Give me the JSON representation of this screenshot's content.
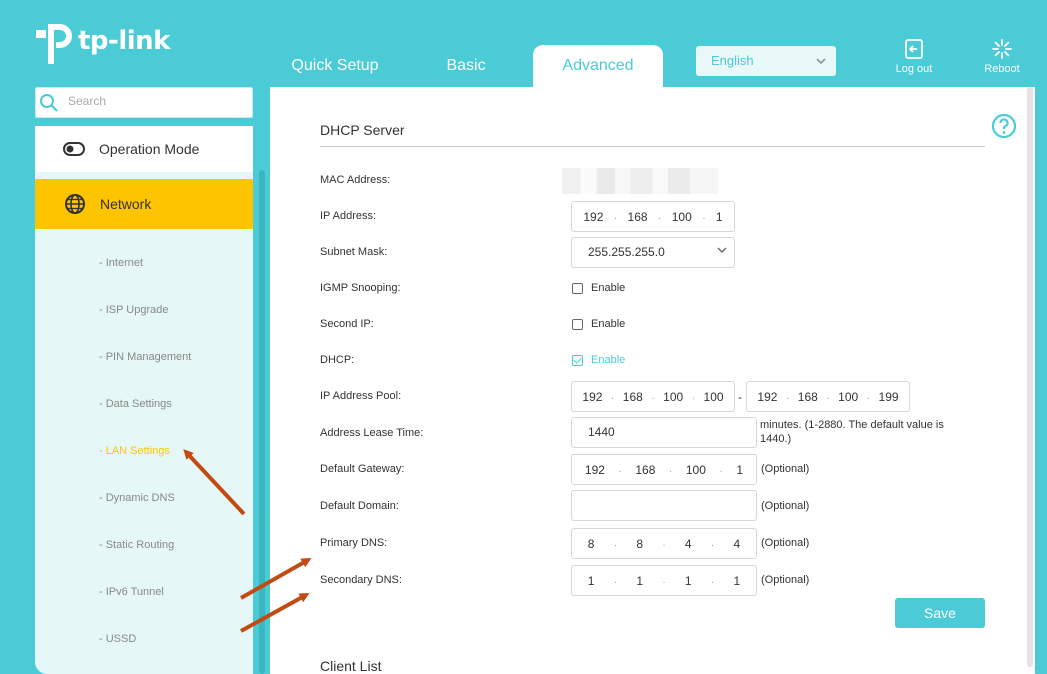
{
  "header": {
    "logo_text": "tp-link",
    "tabs": [
      {
        "label": "Quick Setup"
      },
      {
        "label": "Basic"
      },
      {
        "label": "Advanced"
      }
    ],
    "language": "English",
    "logout_label": "Log out",
    "reboot_label": "Reboot"
  },
  "sidebar": {
    "search_placeholder": "Search",
    "operation_mode": "Operation Mode",
    "network": "Network",
    "sub_items": [
      {
        "label": "- Internet"
      },
      {
        "label": "- ISP Upgrade"
      },
      {
        "label": "- PIN Management"
      },
      {
        "label": "- Data Settings"
      },
      {
        "label": "- LAN Settings"
      },
      {
        "label": "- Dynamic DNS"
      },
      {
        "label": "- Static Routing"
      },
      {
        "label": "- IPv6 Tunnel"
      },
      {
        "label": "- USSD"
      }
    ]
  },
  "dhcp": {
    "title": "DHCP Server",
    "mac_label": "MAC Address:",
    "ip_label": "IP Address:",
    "ip": [
      "192",
      "168",
      "100",
      "1"
    ],
    "subnet_label": "Subnet Mask:",
    "subnet": "255.255.255.0",
    "igmp_label": "IGMP Snooping:",
    "igmp_enable": "Enable",
    "second_ip_label": "Second IP:",
    "second_ip_enable": "Enable",
    "dhcp_label": "DHCP:",
    "dhcp_enable": "Enable",
    "pool_label": "IP Address Pool:",
    "pool_start": [
      "192",
      "168",
      "100",
      "100"
    ],
    "pool_end": [
      "192",
      "168",
      "100",
      "199"
    ],
    "pool_sep": "-",
    "lease_label": "Address Lease Time:",
    "lease": "1440",
    "lease_hint": "minutes. (1-2880. The default value is 1440.)",
    "gateway_label": "Default Gateway:",
    "gateway": [
      "192",
      "168",
      "100",
      "1"
    ],
    "optional": "(Optional)",
    "domain_label": "Default Domain:",
    "domain": "",
    "primary_dns_label": "Primary DNS:",
    "primary_dns": [
      "8",
      "8",
      "4",
      "4"
    ],
    "secondary_dns_label": "Secondary DNS:",
    "secondary_dns": [
      "1",
      "1",
      "1",
      "1"
    ],
    "save_label": "Save"
  },
  "client_list_title": "Client List",
  "colors": {
    "accent": "#4acbd6",
    "highlight": "#ffc400",
    "annotation": "#c24b12"
  }
}
